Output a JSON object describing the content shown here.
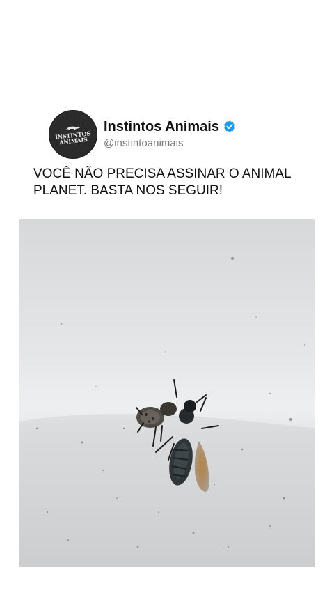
{
  "post": {
    "author": {
      "display_name": "Instintos Animais",
      "handle": "@instintoanimais",
      "verified": true,
      "avatar_text": "INSTINTOS ANIMAIS",
      "verified_color": "#1d9bf0"
    },
    "text": "VOCÊ NÃO PRECISA ASSINAR O ANIMAL PLANET. BASTA NOS SEGUIR!",
    "media": {
      "type": "photo",
      "icon": "spider-with-fly-photo"
    }
  }
}
